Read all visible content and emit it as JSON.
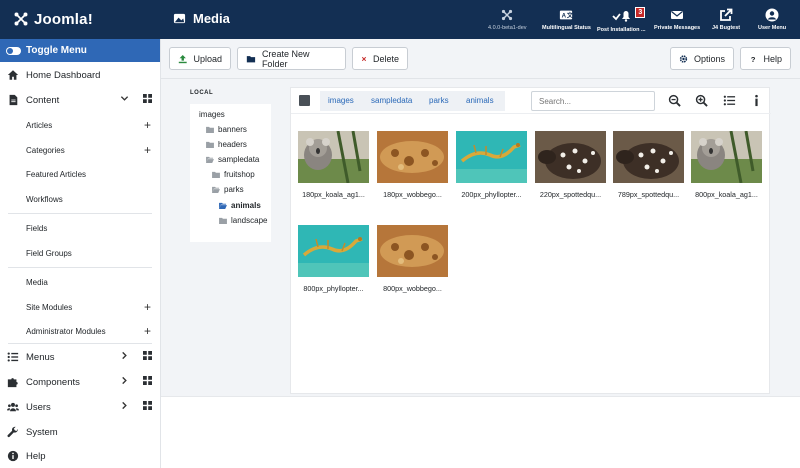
{
  "header": {
    "logo_text": "Joomla!",
    "page_title": "Media",
    "version": "4.0.0-beta1-dev",
    "multilingual": "Multilingual Status",
    "post_install": "Post Installation ...",
    "post_install_count": "3",
    "private_messages": "Private Messages",
    "bugtest": "J4 Bugtest",
    "user_menu": "User Menu"
  },
  "sidebar": {
    "toggle": "Toggle Menu",
    "home": "Home Dashboard",
    "content": "Content",
    "articles": "Articles",
    "categories": "Categories",
    "featured": "Featured Articles",
    "workflows": "Workflows",
    "fields": "Fields",
    "field_groups": "Field Groups",
    "media": "Media",
    "site_modules": "Site Modules",
    "admin_modules": "Administrator Modules",
    "menus": "Menus",
    "components": "Components",
    "users": "Users",
    "system": "System",
    "help": "Help"
  },
  "toolbar": {
    "upload": "Upload",
    "create_folder": "Create New Folder",
    "delete": "Delete",
    "options": "Options",
    "help": "Help"
  },
  "tree": {
    "label": "LOCAL",
    "root": "images",
    "items": [
      "banners",
      "headers",
      "sampledata",
      "fruitshop",
      "parks",
      "animals",
      "landscape"
    ]
  },
  "breadcrumb": [
    "images",
    "sampledata",
    "parks",
    "animals"
  ],
  "search": {
    "placeholder": "Search..."
  },
  "files": [
    "180px_koala_ag1...",
    "180px_wobbego...",
    "200px_phyllopter...",
    "220px_spottedqu...",
    "789px_spottedqu...",
    "800px_koala_ag1...",
    "800px_phyllopter...",
    "800px_wobbego..."
  ],
  "colors": {
    "header": "#132f53",
    "accent": "#2f68b6",
    "badge": "#c52827",
    "link": "#2a69b8"
  }
}
